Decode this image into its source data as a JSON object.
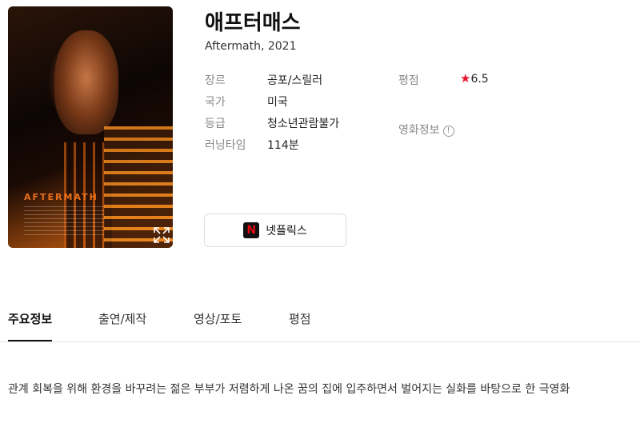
{
  "movie": {
    "title": "애프터매스",
    "subtitle": "Aftermath, 2021",
    "poster_title": "AFTERMATH"
  },
  "info": {
    "genre_label": "장르",
    "genre_value": "공포/스릴러",
    "country_label": "국가",
    "country_value": "미국",
    "grade_label": "등급",
    "grade_value": "청소년관람불가",
    "runtime_label": "러닝타임",
    "runtime_value": "114분",
    "rating_label": "평점",
    "rating_star": "★",
    "rating_value": "6.5",
    "movie_info_label": "영화정보",
    "movie_info_icon": "!"
  },
  "netflix": {
    "logo": "N",
    "label": "넷플릭스"
  },
  "tabs": [
    {
      "label": "주요정보"
    },
    {
      "label": "출연/제작"
    },
    {
      "label": "영상/포토"
    },
    {
      "label": "평점"
    }
  ],
  "description": "관계 회복을 위해 환경을 바꾸려는 젊은 부부가 저렴하게 나온 꿈의 집에 입주하면서 벌어지는 실화를 바탕으로 한 극영화",
  "colors": {
    "rating_star": "#e8112d",
    "netflix_red": "#e50914",
    "poster_accent": "#e8711a"
  }
}
